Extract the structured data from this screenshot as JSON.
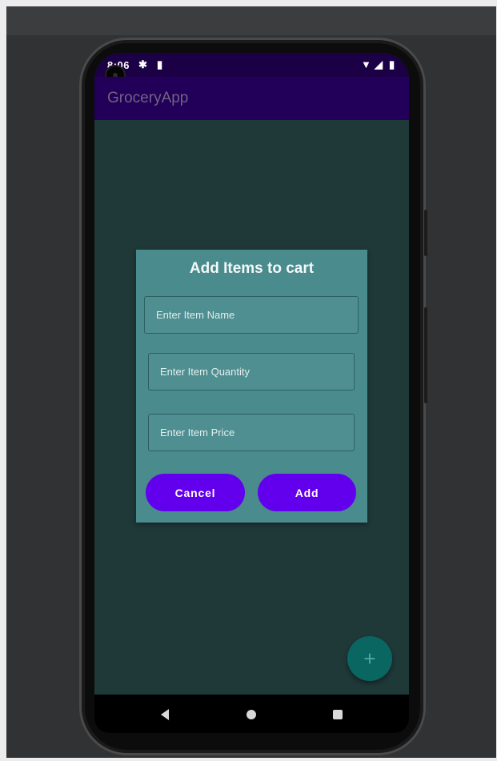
{
  "status_bar": {
    "time": "8:06",
    "icons": [
      "settings-icon",
      "sd-card-icon",
      "wifi-icon",
      "signal-icon",
      "battery-icon"
    ]
  },
  "app_bar": {
    "title": "GroceryApp"
  },
  "dialog": {
    "title": "Add Items to cart",
    "fields": {
      "item_name": {
        "placeholder": "Enter Item Name",
        "value": ""
      },
      "item_quantity": {
        "placeholder": "Enter Item Quantity",
        "value": ""
      },
      "item_price": {
        "placeholder": "Enter Item Price",
        "value": ""
      }
    },
    "buttons": {
      "cancel_label": "Cancel",
      "add_label": "Add"
    }
  },
  "fab": {
    "icon": "plus-icon",
    "label": "+"
  },
  "navigation": {
    "icons": [
      "back-icon",
      "home-icon",
      "recents-icon"
    ]
  },
  "colors": {
    "app_bar": "#22005a",
    "screen_background": "#1f3838",
    "dialog_background": "#4a8b8d",
    "button": "#6200ee",
    "fab": "#0a6661"
  }
}
